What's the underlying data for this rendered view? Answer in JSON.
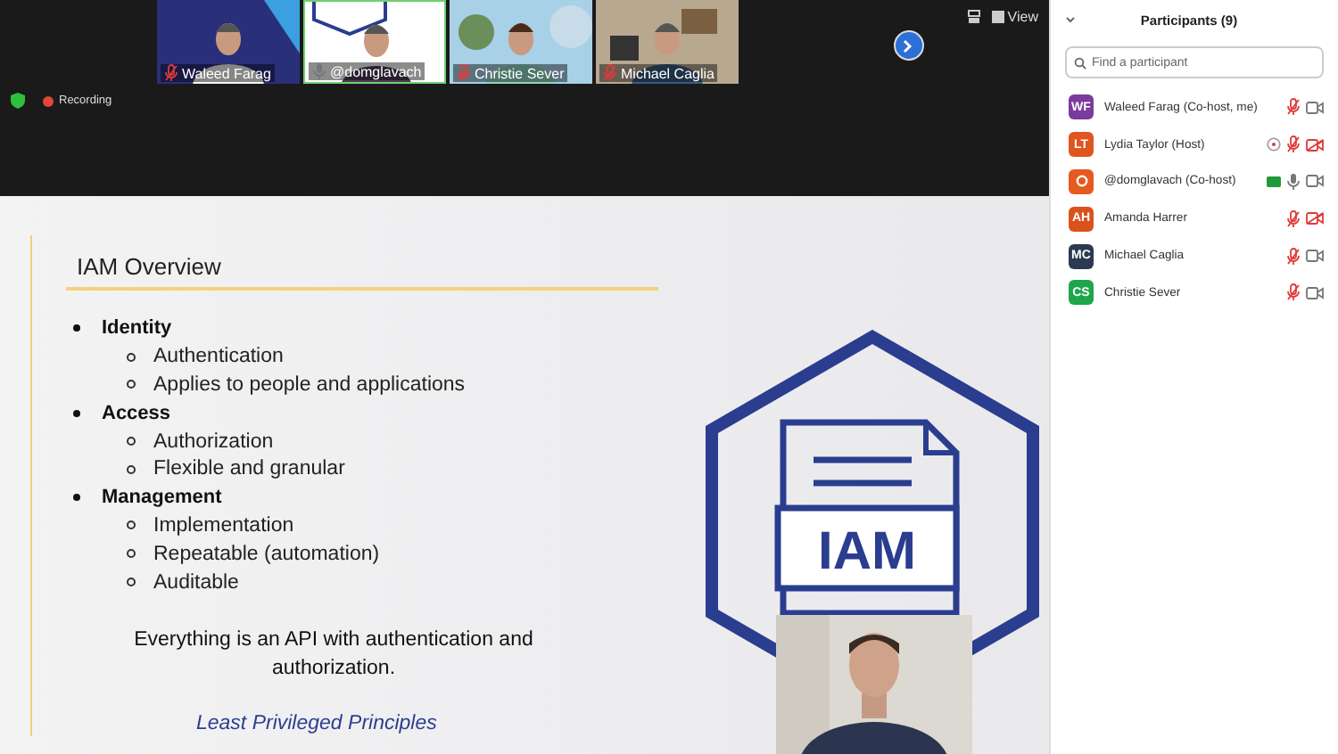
{
  "videos": [
    {
      "name": "Waleed Farag",
      "mic_muted": true,
      "active": false
    },
    {
      "name": "@domglavach",
      "mic_muted": false,
      "active": true
    },
    {
      "name": "Christie Sever",
      "mic_muted": true,
      "active": false
    },
    {
      "name": "Michael Caglia",
      "mic_muted": true,
      "active": false
    }
  ],
  "view_button": "View",
  "recording": "Recording",
  "slide": {
    "title": "IAM Overview",
    "bullets": [
      {
        "text": "Identity",
        "children": [
          {
            "text": "Authentication"
          },
          {
            "text": "Applies to people and applications"
          }
        ]
      },
      {
        "text": "Access",
        "children": [
          {
            "text": "Authorization"
          },
          {
            "text": "Flexible and granular"
          }
        ]
      },
      {
        "text": "Management",
        "children": [
          {
            "text": "Implementation"
          },
          {
            "text": "Repeatable (automation)"
          },
          {
            "text": "Auditable"
          }
        ]
      }
    ],
    "statement": "Everything is an API with authentication and authorization.",
    "tagline": "Least Privileged Principles",
    "badge_label": "IAM"
  },
  "participants": {
    "title": "Participants (9)",
    "search": {
      "placeholder": "Find a participant"
    },
    "items": [
      {
        "initials": "WF",
        "color": "#7b3a9e",
        "name": "Waleed Farag (Co-host, me)",
        "mic_muted": true,
        "video_off": false
      },
      {
        "initials": "LT",
        "color": "#e0561f",
        "name": "Lydia Taylor (Host)",
        "clock_shown": true,
        "mic_muted": true,
        "video_off": true
      },
      {
        "color": "#e55a20",
        "name": "@domglavach (Co-host)",
        "tag_shown": true,
        "mic_muted": false,
        "video_off": false
      },
      {
        "initials": "AH",
        "color": "#d9521d",
        "name": "Amanda Harrer",
        "mic_muted": true,
        "video_off": true
      },
      {
        "initials": "MC",
        "color": "#2b3a50",
        "name": "Michael Caglia",
        "mic_muted": true,
        "video_off": false
      },
      {
        "initials": "CS",
        "color": "#1fa64b",
        "name": "Christie Sever",
        "mic_muted": true,
        "video_off": false
      }
    ]
  }
}
